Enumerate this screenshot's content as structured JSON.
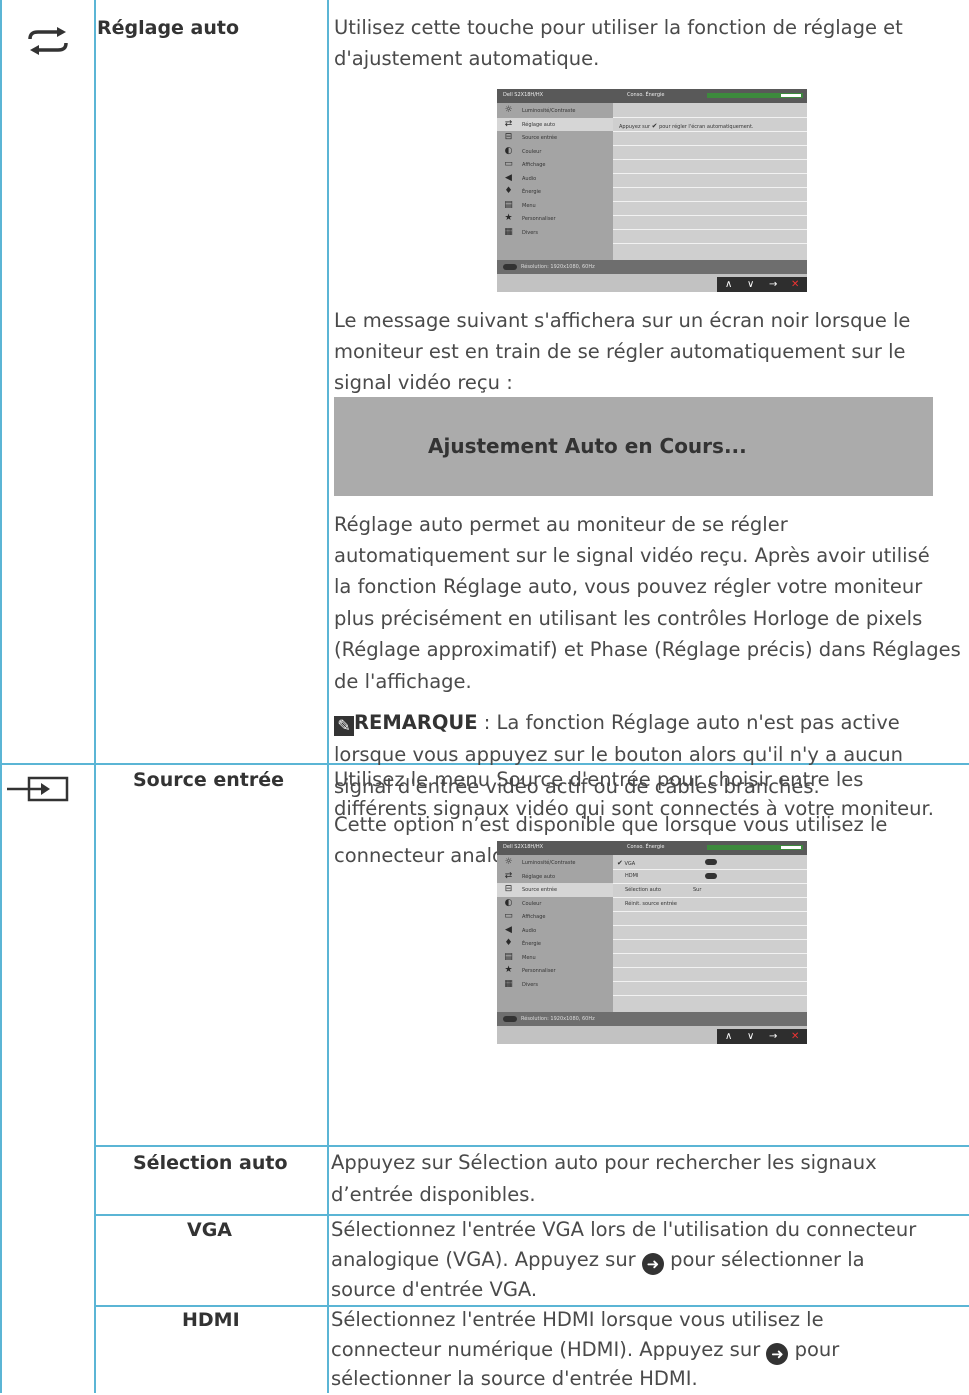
{
  "auto_adjust": {
    "name": "Réglage auto",
    "desc_l1": "Utilisez cette touche pour utiliser la fonction de réglage et",
    "desc_l2": "d'ajustement automatique.",
    "osd": {
      "model": "Dell S2X18H/HX",
      "energy": "Conso. Énergie",
      "items": [
        "Luminosité/Contraste",
        "Réglage auto",
        "Source entrée",
        "Couleur",
        "Affichage",
        "Audio",
        "Énergie",
        "Menu",
        "Personnaliser",
        "Divers"
      ],
      "selected_index": 1,
      "instruction_pre": "Appuyez sur",
      "instruction_post": "pour régler l'écran automatiquement.",
      "resolution": "Résolution: 1920x1080, 60Hz"
    },
    "msg_l1": "Le message suivant s'affichera sur un écran noir lorsque le",
    "msg_l2": "moniteur est en train de se régler automatiquement sur le",
    "msg_l3": "signal vidéo reçu :",
    "box_text": "Ajustement Auto en Cours...",
    "p2_l1": "Réglage auto permet au moniteur de se régler",
    "p2_l2": "automatiquement sur le signal vidéo reçu. Après avoir utilisé",
    "p2_l3": "la fonction Réglage auto, vous pouvez régler votre moniteur",
    "p2_l4": "plus précisément en utilisant les contrôles Horloge de pixels",
    "p2_l5": "(Réglage approximatif) et Phase (Réglage précis) dans Réglages",
    "p2_l6": "de l'affichage.",
    "note_label": "REMARQUE",
    "note_l1": " : La fonction Réglage auto n'est pas active",
    "note_l2": "lorsque vous appuyez sur le bouton alors qu'il n'y a aucun",
    "note_l3": "signal d'entrée vidéo actif ou de câbles branchés.",
    "p3_l1": "Cette option n’est disponible que lorsque vous utilisez le",
    "p3_l2": "connecteur analogique (VGA)."
  },
  "input_source": {
    "name": "Source entrée",
    "desc_l1": "Utilisez le menu Source d'entrée pour choisir entre les",
    "desc_l2": "différents signaux vidéo qui sont connectés à votre moniteur.",
    "osd": {
      "model": "Dell S2X18H/HX",
      "energy": "Conso. Énergie",
      "items": [
        "Luminosité/Contraste",
        "Réglage auto",
        "Source entrée",
        "Couleur",
        "Affichage",
        "Audio",
        "Énergie",
        "Menu",
        "Personnaliser",
        "Divers"
      ],
      "selected_index": 2,
      "vga": "VGA",
      "hdmi": "HDMI",
      "auto_select": "Sélection auto",
      "auto_select_value": "Sur",
      "reset_source": "Réinit. source entrée",
      "resolution": "Résolution: 1920x1080, 60Hz"
    }
  },
  "auto_select": {
    "name": "Sélection auto",
    "l1": "Appuyez sur Sélection auto pour rechercher les signaux",
    "l2": "d’entrée disponibles."
  },
  "vga": {
    "name": "VGA",
    "l1": "Sélectionnez l'entrée VGA lors de l'utilisation du connecteur",
    "l2_pre": "analogique (VGA). Appuyez sur",
    "l2_post": "pour sélectionner la",
    "l3": "source d'entrée VGA."
  },
  "hdmi": {
    "name": "HDMI",
    "l1": "Sélectionnez l'entrée HDMI lorsque vous utilisez le",
    "l2_pre": "connecteur numérique (HDMI). Appuyez sur",
    "l2_post": "pour",
    "l3": "sélectionner la source d'entrée HDMI."
  },
  "colors": {
    "rule": "#5bb5d5",
    "text": "#4a4a4a",
    "box": "#ababab"
  }
}
